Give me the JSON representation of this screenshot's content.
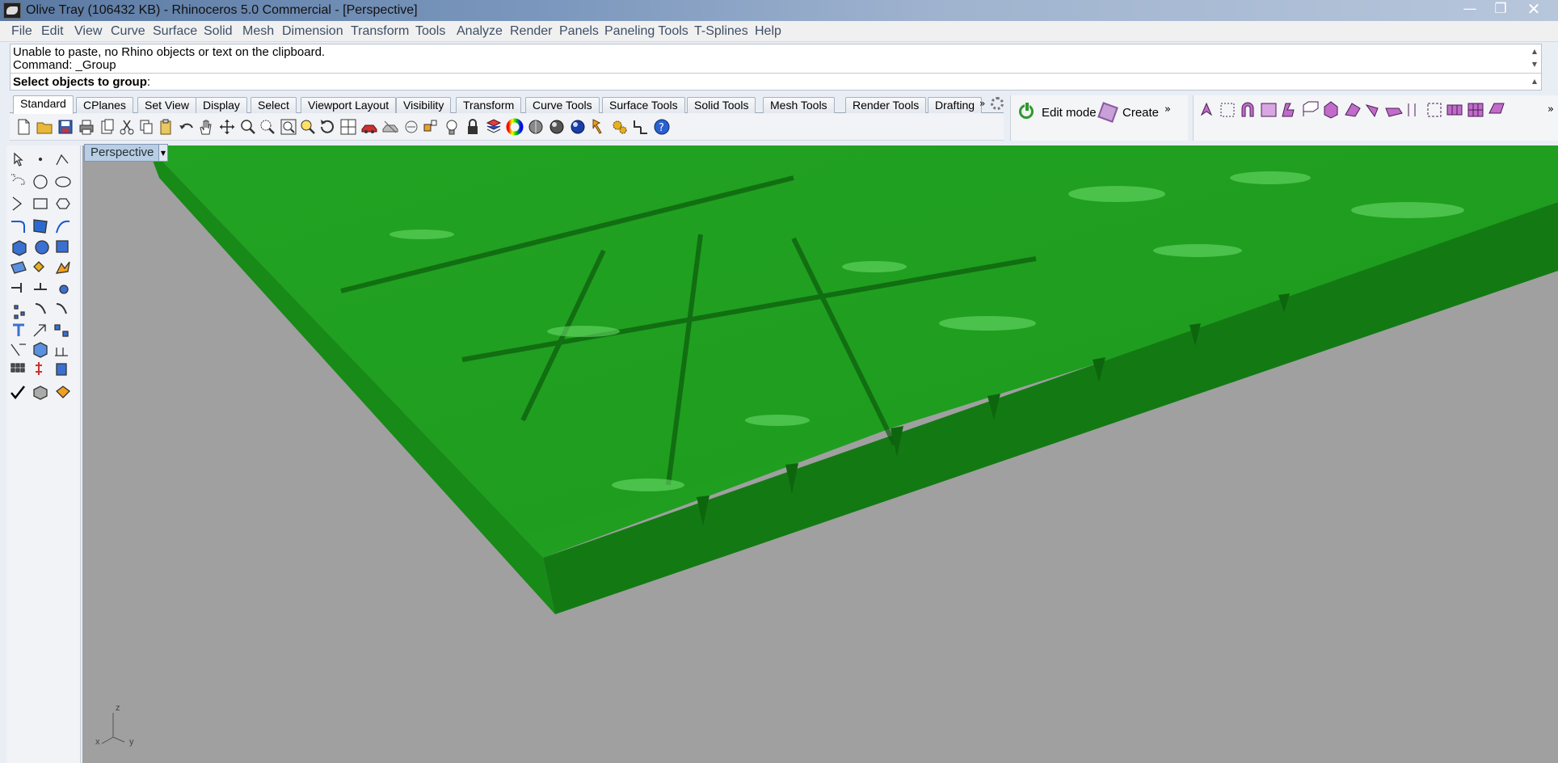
{
  "window": {
    "title": "Olive Tray (106432 KB) - Rhinoceros 5.0 Commercial - [Perspective]",
    "controls": {
      "minimize": "—",
      "maximize": "❐",
      "close": "✕"
    }
  },
  "menubar": {
    "items": [
      "File",
      "Edit",
      "View",
      "Curve",
      "Surface",
      "Solid",
      "Mesh",
      "Dimension",
      "Transform",
      "Tools",
      "Analyze",
      "Render",
      "Panels",
      "Paneling Tools",
      "T-Splines",
      "Help"
    ]
  },
  "command": {
    "history_line_1": "Unable to paste, no Rhino objects or text on the clipboard.",
    "history_line_2": "Command: _Group",
    "prompt_bold": "Select objects to group",
    "prompt_tail": ":"
  },
  "toolbar_tabs": {
    "items": [
      "Standard",
      "CPlanes",
      "Set View",
      "Display",
      "Select",
      "Viewport Layout",
      "Visibility",
      "Transform",
      "Curve Tools",
      "Surface Tools",
      "Solid Tools",
      "Mesh Tools",
      "Render Tools",
      "Drafting"
    ],
    "active": "Standard",
    "overflow": "»"
  },
  "tsplines": {
    "edit_mode_label": "Edit mode",
    "create_label": "Create",
    "overflow": "»",
    "tools_overflow": "»"
  },
  "viewport": {
    "name": "Perspective",
    "dropdown": "▼",
    "axis_labels": {
      "z": "z",
      "x": "x",
      "y": "y"
    }
  },
  "colors": {
    "model_green": "#1f9d1f",
    "background_gray": "#a0a0a0",
    "viewport_tab": "#b9cde4"
  }
}
